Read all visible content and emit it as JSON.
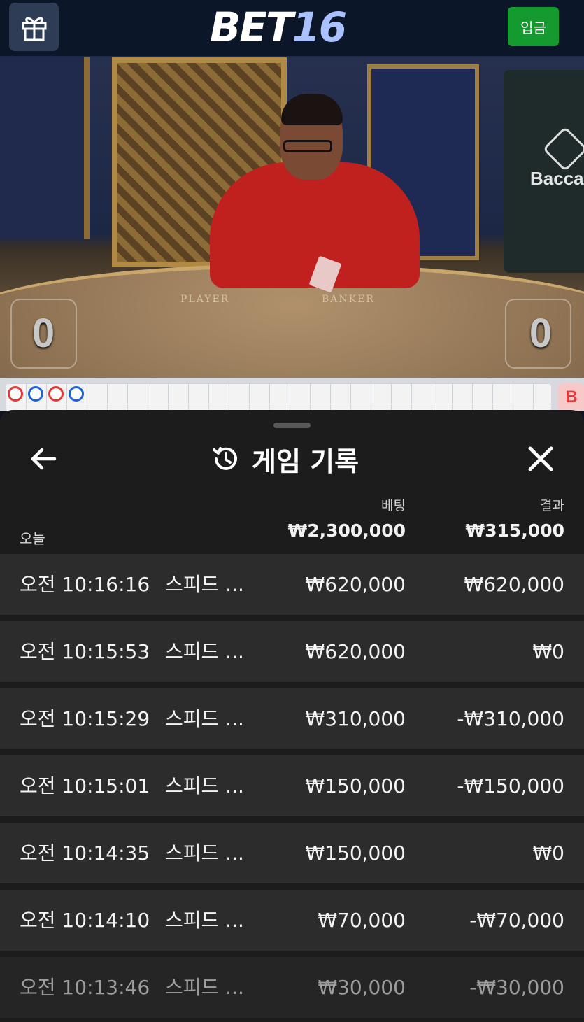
{
  "header": {
    "logo_part1": "BET",
    "logo_part2": "16",
    "deposit_label": "입금"
  },
  "video": {
    "player_label": "PLAYER",
    "banker_label": "BANKER",
    "player_score": "0",
    "banker_score": "0",
    "sign_text": "Bacca"
  },
  "road": {
    "circles": [
      "red",
      "blue",
      "red",
      "blue"
    ],
    "side_badge": "B",
    "colors": {
      "red": "#e53935",
      "blue": "#1e63d6"
    }
  },
  "history": {
    "title": "게임 기록",
    "col_bet": "베팅",
    "col_result": "결과",
    "today_label": "오늘",
    "total_bet": "₩2,300,000",
    "total_result": "₩315,000",
    "rows": [
      {
        "time": "오전 10:16:16",
        "game": "스피드 ...",
        "bet": "₩620,000",
        "result": "₩620,000"
      },
      {
        "time": "오전 10:15:53",
        "game": "스피드 ...",
        "bet": "₩620,000",
        "result": "₩0"
      },
      {
        "time": "오전 10:15:29",
        "game": "스피드 ...",
        "bet": "₩310,000",
        "result": "-₩310,000"
      },
      {
        "time": "오전 10:15:01",
        "game": "스피드 ...",
        "bet": "₩150,000",
        "result": "-₩150,000"
      },
      {
        "time": "오전 10:14:35",
        "game": "스피드 ...",
        "bet": "₩150,000",
        "result": "₩0"
      },
      {
        "time": "오전 10:14:10",
        "game": "스피드 ...",
        "bet": "₩70,000",
        "result": "-₩70,000"
      },
      {
        "time": "오전 10:13:46",
        "game": "스피드 ...",
        "bet": "₩30,000",
        "result": "-₩30,000"
      }
    ]
  },
  "icons": {
    "gift": "gift-icon",
    "back": "arrow-left-icon",
    "history": "history-icon",
    "close": "close-icon"
  }
}
